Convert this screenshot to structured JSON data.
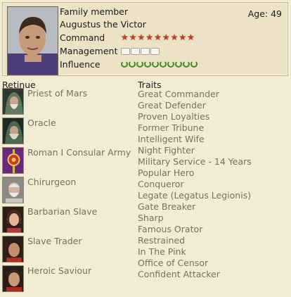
{
  "character": {
    "role": "Family member",
    "name": "Augustus the Victor",
    "age_label": "Age:",
    "age": "49"
  },
  "stats": {
    "command_label": "Command",
    "command_value": 9,
    "management_label": "Management",
    "management_value": 4,
    "influence_label": "Influence",
    "influence_value": 10
  },
  "colors": {
    "star": "#c93a1f",
    "laurel": "#3f8e22",
    "list_text": "#76715e"
  },
  "retinue": {
    "header": "Retinue",
    "items": [
      {
        "label": "Priest of Mars",
        "icon": "priest-portrait-icon"
      },
      {
        "label": "Oracle",
        "icon": "oracle-portrait-icon"
      },
      {
        "label": "Roman I Consular Army",
        "icon": "army-standard-icon"
      },
      {
        "label": "Chirurgeon",
        "icon": "chirurgeon-portrait-icon"
      },
      {
        "label": "Barbarian Slave",
        "icon": "slave-portrait-icon"
      },
      {
        "label": "Slave Trader",
        "icon": "trader-portrait-icon"
      },
      {
        "label": "Heroic Saviour",
        "icon": "saviour-portrait-icon"
      }
    ]
  },
  "traits": {
    "header": "Traits",
    "items": [
      "Great Commander",
      "Great Defender",
      "Proven Loyalties",
      "Former Tribune",
      "Intelligent Wife",
      "Night Fighter",
      "Military Service - 14 Years",
      "Popular Hero",
      "Conqueror",
      "Legate (Legatus Legionis)",
      "Gate Breaker",
      "Sharp",
      "Famous Orator",
      "Restrained",
      "In The Pink",
      "Office of Censor",
      "Confident Attacker"
    ]
  }
}
